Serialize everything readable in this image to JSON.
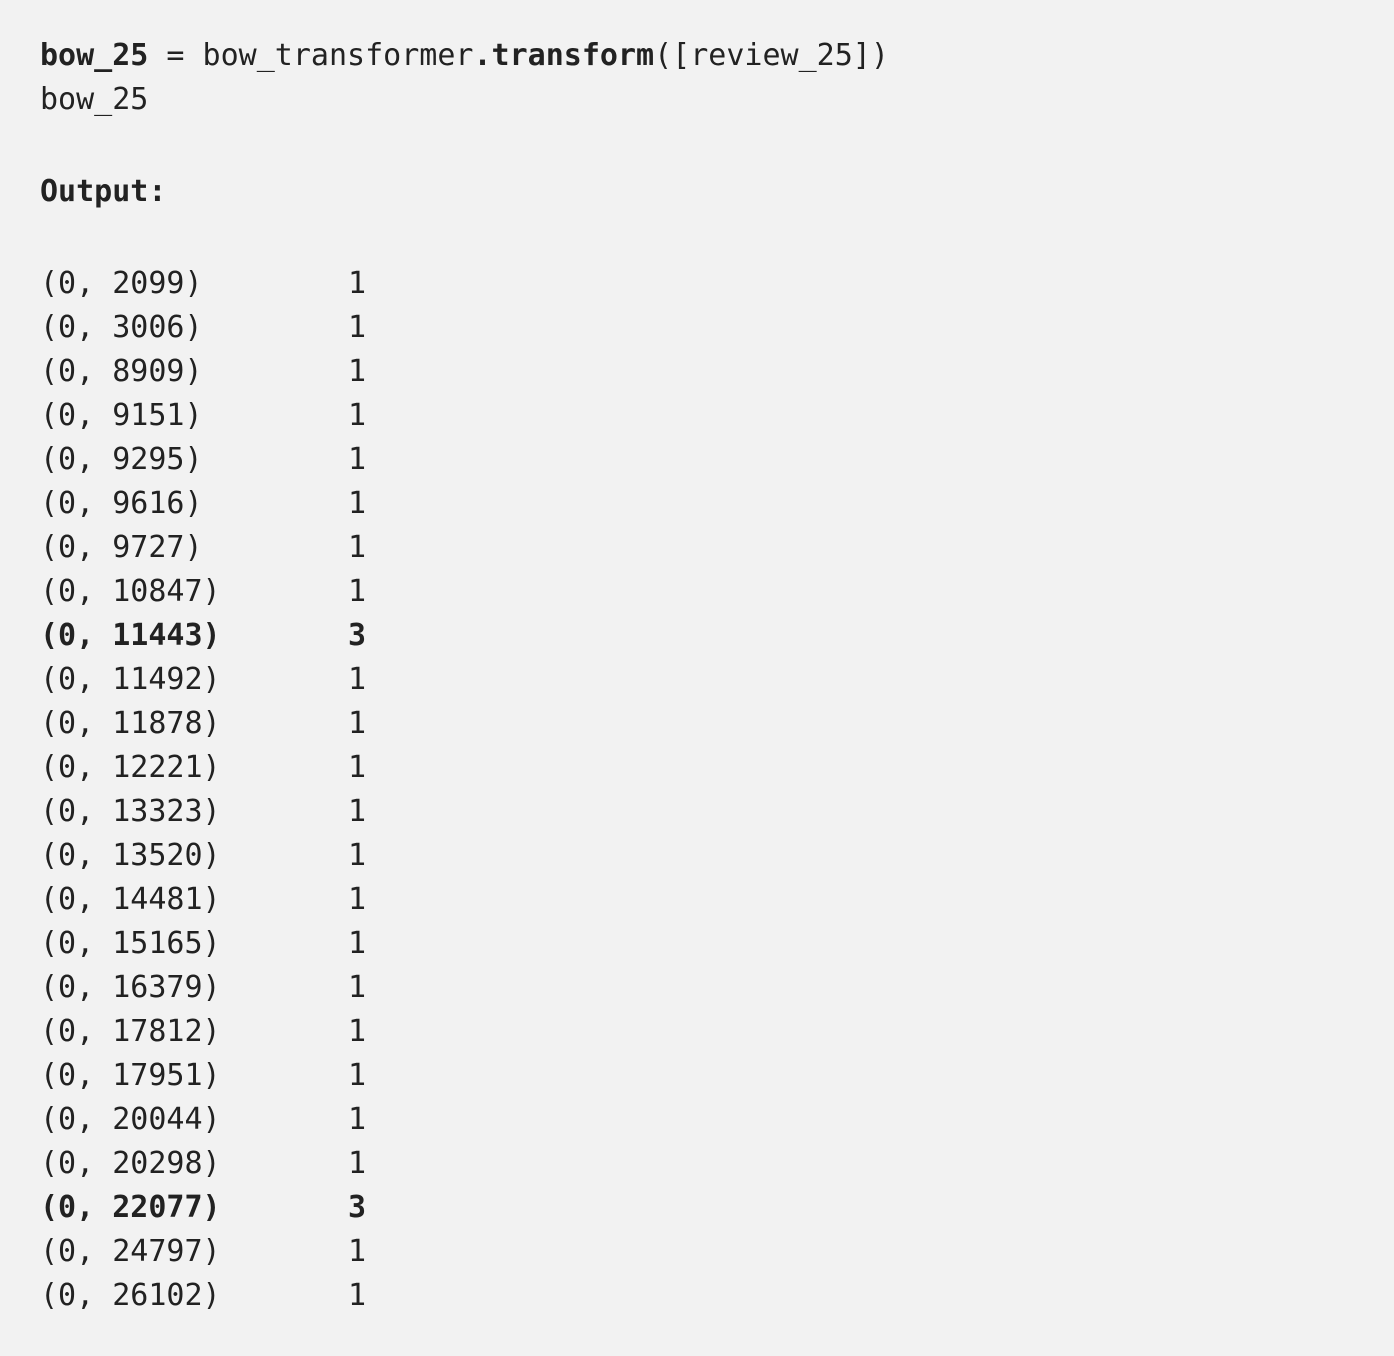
{
  "code": {
    "line1": {
      "var": "bow_25",
      "eq": " = bow_transformer",
      "method": ".transform",
      "args": "([review_25])"
    },
    "line2": "bow_25"
  },
  "output_label": "Output:",
  "rows": [
    {
      "index": "(0, 2099)",
      "count": "1",
      "bold": false
    },
    {
      "index": "(0, 3006)",
      "count": "1",
      "bold": false
    },
    {
      "index": "(0, 8909)",
      "count": "1",
      "bold": false
    },
    {
      "index": "(0, 9151)",
      "count": "1",
      "bold": false
    },
    {
      "index": "(0, 9295)",
      "count": "1",
      "bold": false
    },
    {
      "index": "(0, 9616)",
      "count": "1",
      "bold": false
    },
    {
      "index": "(0, 9727)",
      "count": "1",
      "bold": false
    },
    {
      "index": "(0, 10847)",
      "count": "1",
      "bold": false
    },
    {
      "index": "(0, 11443)",
      "count": "3",
      "bold": true
    },
    {
      "index": "(0, 11492)",
      "count": "1",
      "bold": false
    },
    {
      "index": "(0, 11878)",
      "count": "1",
      "bold": false
    },
    {
      "index": "(0, 12221)",
      "count": "1",
      "bold": false
    },
    {
      "index": "(0, 13323)",
      "count": "1",
      "bold": false
    },
    {
      "index": "(0, 13520)",
      "count": "1",
      "bold": false
    },
    {
      "index": "(0, 14481)",
      "count": "1",
      "bold": false
    },
    {
      "index": "(0, 15165)",
      "count": "1",
      "bold": false
    },
    {
      "index": "(0, 16379)",
      "count": "1",
      "bold": false
    },
    {
      "index": "(0, 17812)",
      "count": "1",
      "bold": false
    },
    {
      "index": "(0, 17951)",
      "count": "1",
      "bold": false
    },
    {
      "index": "(0, 20044)",
      "count": "1",
      "bold": false
    },
    {
      "index": "(0, 20298)",
      "count": "1",
      "bold": false
    },
    {
      "index": "(0, 22077)",
      "count": "3",
      "bold": true
    },
    {
      "index": "(0, 24797)",
      "count": "1",
      "bold": false
    },
    {
      "index": "(0, 26102)",
      "count": "1",
      "bold": false
    }
  ]
}
